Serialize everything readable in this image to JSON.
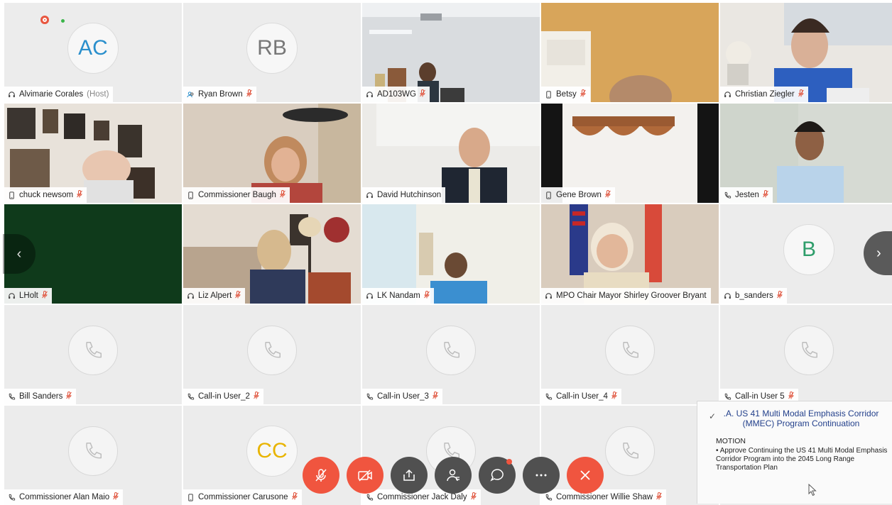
{
  "colors": {
    "accent_red": "#f0553f",
    "dark_button": "#505050",
    "active_border": "#4aa3df",
    "panel_title": "#24418c"
  },
  "participants": [
    {
      "name": "Alvimarie Corales",
      "suffix": "(Host)",
      "device": "headset-icon",
      "muted": false,
      "type": "avatar",
      "initials": "AC",
      "avatar_color": "blue"
    },
    {
      "name": "Ryan Brown",
      "device": "group-icon",
      "muted": true,
      "type": "avatar",
      "initials": "RB",
      "avatar_color": "gray"
    },
    {
      "name": "AD103WG",
      "device": "headset-icon",
      "muted": true,
      "type": "video",
      "scene": "office"
    },
    {
      "name": "Betsy",
      "device": "mobile-icon",
      "muted": true,
      "type": "video",
      "scene": "door"
    },
    {
      "name": "Christian Ziegler",
      "device": "headset-icon",
      "muted": true,
      "type": "video",
      "scene": "blueshirt"
    },
    {
      "name": "chuck newsom",
      "device": "mobile-icon",
      "muted": true,
      "type": "video",
      "scene": "frames"
    },
    {
      "name": "Commissioner Baugh",
      "device": "mobile-icon",
      "muted": true,
      "type": "video",
      "scene": "woman-red"
    },
    {
      "name": "David Hutchinson",
      "device": "headset-icon",
      "muted": false,
      "type": "video",
      "scene": "suit"
    },
    {
      "name": "Gene Brown",
      "device": "mobile-icon",
      "muted": true,
      "type": "video",
      "scene": "curtain"
    },
    {
      "name": "Jesten",
      "device": "phone-icon",
      "muted": true,
      "type": "video",
      "scene": "man-blue"
    },
    {
      "name": "LHolt",
      "device": "headset-icon",
      "muted": true,
      "type": "video",
      "scene": "green"
    },
    {
      "name": "Liz Alpert",
      "device": "headset-icon",
      "muted": true,
      "type": "video",
      "scene": "living"
    },
    {
      "name": "LK Nandam",
      "device": "headset-icon",
      "muted": true,
      "type": "video",
      "scene": "room"
    },
    {
      "name": "MPO Chair Mayor Shirley Groover Bryant",
      "device": "headset-icon",
      "muted": false,
      "type": "video",
      "scene": "flags",
      "active": true
    },
    {
      "name": "b_sanders",
      "device": "headset-icon",
      "muted": true,
      "type": "avatar",
      "initials": "B",
      "avatar_color": "green"
    },
    {
      "name": "Bill Sanders",
      "device": "phone-icon",
      "muted": true,
      "type": "phone"
    },
    {
      "name": "Call-in User_2",
      "device": "phone-icon",
      "muted": true,
      "type": "phone"
    },
    {
      "name": "Call-in User_3",
      "device": "phone-icon",
      "muted": true,
      "type": "phone"
    },
    {
      "name": "Call-in User_4",
      "device": "phone-icon",
      "muted": true,
      "type": "phone"
    },
    {
      "name": "Call-in User 5",
      "device": "phone-icon",
      "muted": true,
      "type": "phone"
    },
    {
      "name": "Commissioner Alan Maio",
      "device": "phone-icon",
      "muted": true,
      "type": "phone"
    },
    {
      "name": "Commissioner Carusone",
      "device": "mobile-icon",
      "muted": true,
      "type": "avatar",
      "initials": "CC",
      "avatar_color": "gold"
    },
    {
      "name": "Commissioner Jack Daly",
      "device": "phone-icon",
      "muted": true,
      "type": "phone"
    },
    {
      "name": "Commissioner Willie Shaw",
      "device": "phone-icon",
      "muted": true,
      "type": "phone"
    },
    {
      "name": "",
      "device": "",
      "muted": false,
      "type": "empty"
    }
  ],
  "toolbar": [
    {
      "icon": "microphone-muted-icon",
      "style": "red"
    },
    {
      "icon": "video-off-icon",
      "style": "red"
    },
    {
      "icon": "share-icon",
      "style": "dark"
    },
    {
      "icon": "participants-icon",
      "style": "dark"
    },
    {
      "icon": "chat-icon",
      "style": "dark",
      "badge": true
    },
    {
      "icon": "more-icon",
      "style": "dark"
    },
    {
      "icon": "end-call-icon",
      "style": "red"
    }
  ],
  "agenda_panel": {
    "title": ".A. US 41 Multi Modal Emphasis Corridor (MMEC) Program Continuation",
    "section": "MOTION",
    "bullet": "Approve Continuing the US 41 Multi Modal Emphasis Corridor Program into the 2045 Long Range Transportation Plan"
  },
  "nav": {
    "prev": "‹",
    "next": "›"
  }
}
